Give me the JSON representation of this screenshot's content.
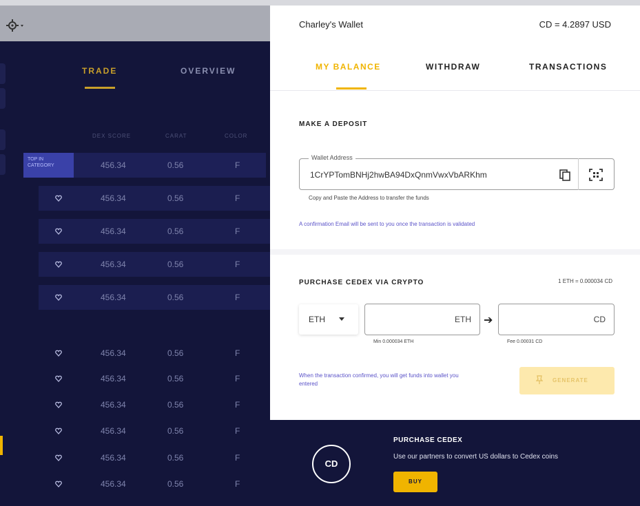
{
  "colors": {
    "accent": "#f0b400",
    "dark_bg": "#13153a",
    "row_bg": "#1b1e50",
    "link": "#5a52c8"
  },
  "icons": [
    "gear-icon",
    "heart-icon",
    "copy-icon",
    "qr-scan-icon",
    "arrow-right-icon",
    "caret-down-icon",
    "pin-icon"
  ],
  "left": {
    "tabs": [
      {
        "label": "TRADE"
      },
      {
        "label": "OVERVIEW"
      }
    ],
    "columns": [
      "DEX SCORE",
      "CARAT",
      "COLOR"
    ],
    "badge": "TOP IN CATEGORY",
    "rows": [
      {
        "score": "456.34",
        "carat": "0.56",
        "color": "F"
      },
      {
        "score": "456.34",
        "carat": "0.56",
        "color": "F"
      },
      {
        "score": "456.34",
        "carat": "0.56",
        "color": "F"
      },
      {
        "score": "456.34",
        "carat": "0.56",
        "color": "F"
      },
      {
        "score": "456.34",
        "carat": "0.56",
        "color": "F"
      },
      {
        "score": "456.34",
        "carat": "0.56",
        "color": "F"
      },
      {
        "score": "456.34",
        "carat": "0.56",
        "color": "F"
      },
      {
        "score": "456.34",
        "carat": "0.56",
        "color": "F"
      },
      {
        "score": "456.34",
        "carat": "0.56",
        "color": "F"
      },
      {
        "score": "456.34",
        "carat": "0.56",
        "color": "F"
      },
      {
        "score": "456.34",
        "carat": "0.56",
        "color": "F"
      }
    ]
  },
  "wallet": {
    "title": "Charley's Wallet",
    "rate": "CD = 4.2897 USD",
    "tabs": [
      {
        "label": "MY BALANCE"
      },
      {
        "label": "WITHDRAW"
      },
      {
        "label": "TRANSACTIONS"
      }
    ],
    "deposit": {
      "title": "MAKE A DEPOSIT",
      "address_label": "Wallet Address",
      "address": "1CrYPTomBNHj2hwBA94DxQnmVwxVbARKhm",
      "hint": "Copy and Paste the Address to transfer the funds",
      "notice": "A confirmation Email will be sent to you once the transaction is validated"
    },
    "purchase": {
      "title": "PURCHASE CEDEX VIA CRYPTO",
      "rate": "1 ETH = 0.000034 CD",
      "currency": "ETH",
      "from_unit": "ETH",
      "to_unit": "CD",
      "min": "Min 0.000034 ETH",
      "fee": "Fee 0.00031 CD",
      "confirmation": "When the transaction confirmed, you will get funds into wallet you entered",
      "generate_label": "GENERATE"
    }
  },
  "promo": {
    "logo": "CD",
    "title": "PURCHASE CEDEX",
    "desc": "Use our partners to convert US dollars to Cedex coins",
    "buy_label": "BUY"
  }
}
